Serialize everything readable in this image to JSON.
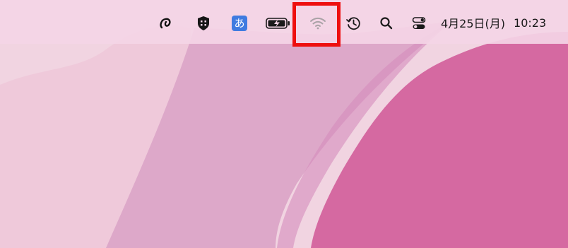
{
  "menubar": {
    "icons": {
      "app_icon": "loop-swirl-icon",
      "shield_icon": "shield-grid-icon",
      "input_method_icon": "hiragana-input-icon",
      "battery_icon": "battery-charging-icon",
      "wifi_icon": "wifi-icon",
      "time_machine_icon": "time-machine-icon",
      "spotlight_icon": "search-icon",
      "control_center_icon": "control-center-icon"
    },
    "input_method_label": "あ",
    "date": "4月25日(月)",
    "time": "10:23"
  },
  "highlight": {
    "target": "wifi-icon",
    "color": "#ee0f0f"
  },
  "colors": {
    "menubar_bg": "#f4d5e6",
    "wallpaper_light": "#f1d4e1",
    "wallpaper_mid": "#dca5c8",
    "wallpaper_dark": "#d569a1",
    "input_method_bg": "#3f7be0"
  }
}
